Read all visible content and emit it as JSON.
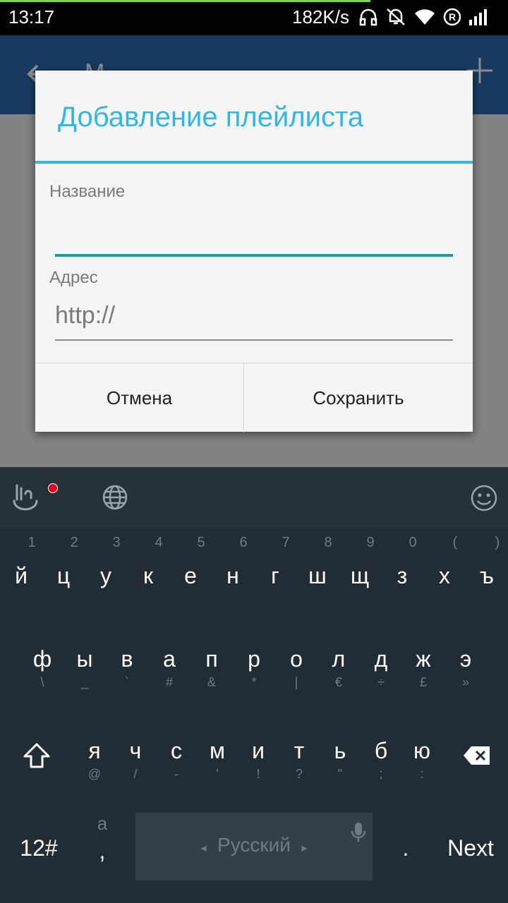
{
  "status_bar": {
    "time": "13:17",
    "speed": "182K/s",
    "icons": [
      "headphones-icon",
      "mute-icon",
      "wifi-icon",
      "registered-icon",
      "signal-icon"
    ]
  },
  "app_bar": {
    "title": "М..."
  },
  "dialog": {
    "title": "Добавление плейлиста",
    "name_label": "Название",
    "name_value": "",
    "address_label": "Адрес",
    "address_placeholder": "http://",
    "cancel_label": "Отмена",
    "save_label": "Сохранить",
    "accent_color": "#33b5e5",
    "focus_color": "#1e9e96"
  },
  "keyboard": {
    "number_row": [
      "1",
      "2",
      "3",
      "4",
      "5",
      "6",
      "7",
      "8",
      "9",
      "0",
      "(",
      ")"
    ],
    "row1": [
      "й",
      "ц",
      "у",
      "к",
      "е",
      "н",
      "г",
      "ш",
      "щ",
      "з",
      "х",
      "ъ"
    ],
    "row2": [
      {
        "main": "ф",
        "sub": "\\"
      },
      {
        "main": "ы",
        "sub": "_"
      },
      {
        "main": "в",
        "sub": "`"
      },
      {
        "main": "а",
        "sub": "#"
      },
      {
        "main": "п",
        "sub": "&"
      },
      {
        "main": "р",
        "sub": "*"
      },
      {
        "main": "о",
        "sub": "|"
      },
      {
        "main": "л",
        "sub": "€"
      },
      {
        "main": "д",
        "sub": "÷"
      },
      {
        "main": "ж",
        "sub": "£"
      },
      {
        "main": "э",
        "sub": "»"
      }
    ],
    "row3": [
      {
        "main": "я",
        "sub": "@"
      },
      {
        "main": "ч",
        "sub": "/"
      },
      {
        "main": "с",
        "sub": "-"
      },
      {
        "main": "м",
        "sub": "'"
      },
      {
        "main": "и",
        "sub": "!"
      },
      {
        "main": "т",
        "sub": "?"
      },
      {
        "main": "ь",
        "sub": "\""
      },
      {
        "main": "б",
        "sub": ";"
      },
      {
        "main": "ю",
        "sub": ":"
      }
    ],
    "symbols_label": "12#",
    "comma_top": "a",
    "comma_label": ",",
    "language_label": "Русский",
    "period_label": ".",
    "next_label": "Next"
  }
}
